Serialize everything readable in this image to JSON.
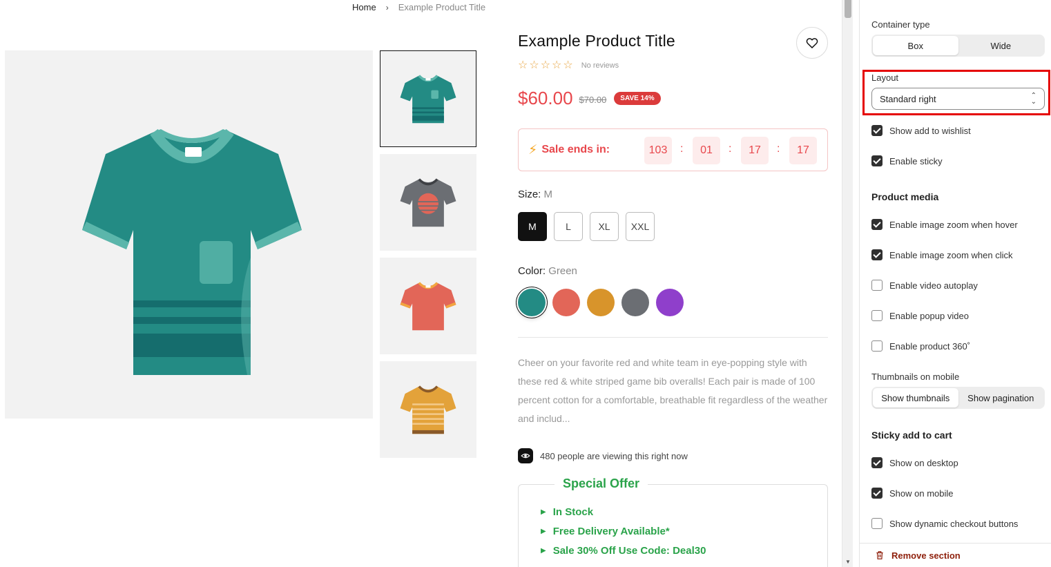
{
  "breadcrumb": {
    "home": "Home",
    "separator": "›",
    "current": "Example Product Title"
  },
  "product": {
    "title": "Example Product Title",
    "reviews_text": "No reviews",
    "rating_stars": 0,
    "price": "$60.00",
    "compare_price": "$70.00",
    "save_badge": "SAVE 14%",
    "countdown": {
      "label": "Sale ends in:",
      "days": "103",
      "hours": "01",
      "minutes": "17",
      "seconds": "17",
      "separator": ":"
    },
    "size": {
      "label": "Size:",
      "selected": "M",
      "options": [
        "M",
        "L",
        "XL",
        "XXL"
      ]
    },
    "color": {
      "label": "Color:",
      "selected": "Green",
      "swatches": [
        {
          "name": "Green",
          "hex": "#238b84"
        },
        {
          "name": "Red",
          "hex": "#e26658"
        },
        {
          "name": "Orange",
          "hex": "#d8942b"
        },
        {
          "name": "Gray",
          "hex": "#6b6e73"
        },
        {
          "name": "Purple",
          "hex": "#8f3fcb"
        }
      ]
    },
    "description": "Cheer on your favorite red and white team in eye-popping style with these red & white striped game bib overalls! Each pair is made of 100 percent cotton for a comfortable, breathable fit regardless of the weather and includ...",
    "viewers_text": "480 people are viewing this right now",
    "special_offer": {
      "title": "Special Offer",
      "items": [
        "In Stock",
        "Free Delivery Available*",
        "Sale 30% Off Use Code: Deal30"
      ]
    },
    "thumbnails": [
      {
        "color": "#238b84",
        "icon": "tshirt-green"
      },
      {
        "color": "#6b6e73",
        "icon": "tshirt-gray"
      },
      {
        "color": "#e26658",
        "icon": "tshirt-red"
      },
      {
        "color": "#e3a23a",
        "icon": "tshirt-yellow"
      }
    ]
  },
  "settings": {
    "container_type": {
      "label": "Container type",
      "options": [
        "Box",
        "Wide"
      ],
      "selected": "Box"
    },
    "layout": {
      "label": "Layout",
      "value": "Standard right"
    },
    "show_add_to_wishlist": {
      "label": "Show add to wishlist",
      "checked": true
    },
    "enable_sticky": {
      "label": "Enable sticky",
      "checked": true
    },
    "product_media": {
      "heading": "Product media",
      "options": [
        {
          "label": "Enable image zoom when hover",
          "checked": true
        },
        {
          "label": "Enable image zoom when click",
          "checked": true
        },
        {
          "label": "Enable video autoplay",
          "checked": false
        },
        {
          "label": "Enable popup video",
          "checked": false
        },
        {
          "label": "Enable product 360˚",
          "checked": false
        }
      ]
    },
    "thumbnails_on_mobile": {
      "label": "Thumbnails on mobile",
      "options": [
        "Show thumbnails",
        "Show pagination"
      ],
      "selected": "Show thumbnails"
    },
    "sticky_add_to_cart": {
      "heading": "Sticky add to cart",
      "options": [
        {
          "label": "Show on desktop",
          "checked": true
        },
        {
          "label": "Show on mobile",
          "checked": true
        },
        {
          "label": "Show dynamic checkout buttons",
          "checked": false
        }
      ]
    },
    "remove_section": "Remove section"
  }
}
